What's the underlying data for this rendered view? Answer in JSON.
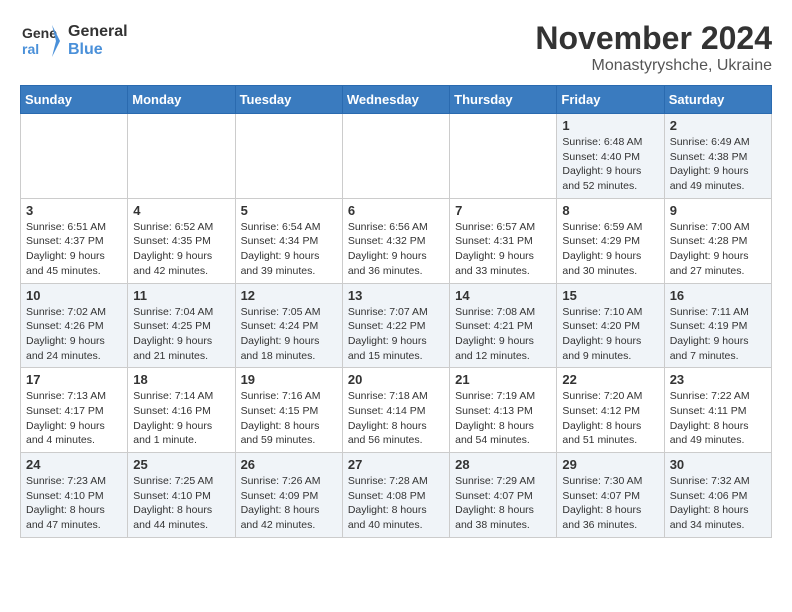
{
  "logo": {
    "line1": "General",
    "line2": "Blue"
  },
  "title": "November 2024",
  "subtitle": "Monastyryshche, Ukraine",
  "days_of_week": [
    "Sunday",
    "Monday",
    "Tuesday",
    "Wednesday",
    "Thursday",
    "Friday",
    "Saturday"
  ],
  "weeks": [
    [
      {
        "day": "",
        "info": ""
      },
      {
        "day": "",
        "info": ""
      },
      {
        "day": "",
        "info": ""
      },
      {
        "day": "",
        "info": ""
      },
      {
        "day": "",
        "info": ""
      },
      {
        "day": "1",
        "info": "Sunrise: 6:48 AM\nSunset: 4:40 PM\nDaylight: 9 hours\nand 52 minutes."
      },
      {
        "day": "2",
        "info": "Sunrise: 6:49 AM\nSunset: 4:38 PM\nDaylight: 9 hours\nand 49 minutes."
      }
    ],
    [
      {
        "day": "3",
        "info": "Sunrise: 6:51 AM\nSunset: 4:37 PM\nDaylight: 9 hours\nand 45 minutes."
      },
      {
        "day": "4",
        "info": "Sunrise: 6:52 AM\nSunset: 4:35 PM\nDaylight: 9 hours\nand 42 minutes."
      },
      {
        "day": "5",
        "info": "Sunrise: 6:54 AM\nSunset: 4:34 PM\nDaylight: 9 hours\nand 39 minutes."
      },
      {
        "day": "6",
        "info": "Sunrise: 6:56 AM\nSunset: 4:32 PM\nDaylight: 9 hours\nand 36 minutes."
      },
      {
        "day": "7",
        "info": "Sunrise: 6:57 AM\nSunset: 4:31 PM\nDaylight: 9 hours\nand 33 minutes."
      },
      {
        "day": "8",
        "info": "Sunrise: 6:59 AM\nSunset: 4:29 PM\nDaylight: 9 hours\nand 30 minutes."
      },
      {
        "day": "9",
        "info": "Sunrise: 7:00 AM\nSunset: 4:28 PM\nDaylight: 9 hours\nand 27 minutes."
      }
    ],
    [
      {
        "day": "10",
        "info": "Sunrise: 7:02 AM\nSunset: 4:26 PM\nDaylight: 9 hours\nand 24 minutes."
      },
      {
        "day": "11",
        "info": "Sunrise: 7:04 AM\nSunset: 4:25 PM\nDaylight: 9 hours\nand 21 minutes."
      },
      {
        "day": "12",
        "info": "Sunrise: 7:05 AM\nSunset: 4:24 PM\nDaylight: 9 hours\nand 18 minutes."
      },
      {
        "day": "13",
        "info": "Sunrise: 7:07 AM\nSunset: 4:22 PM\nDaylight: 9 hours\nand 15 minutes."
      },
      {
        "day": "14",
        "info": "Sunrise: 7:08 AM\nSunset: 4:21 PM\nDaylight: 9 hours\nand 12 minutes."
      },
      {
        "day": "15",
        "info": "Sunrise: 7:10 AM\nSunset: 4:20 PM\nDaylight: 9 hours\nand 9 minutes."
      },
      {
        "day": "16",
        "info": "Sunrise: 7:11 AM\nSunset: 4:19 PM\nDaylight: 9 hours\nand 7 minutes."
      }
    ],
    [
      {
        "day": "17",
        "info": "Sunrise: 7:13 AM\nSunset: 4:17 PM\nDaylight: 9 hours\nand 4 minutes."
      },
      {
        "day": "18",
        "info": "Sunrise: 7:14 AM\nSunset: 4:16 PM\nDaylight: 9 hours\nand 1 minute."
      },
      {
        "day": "19",
        "info": "Sunrise: 7:16 AM\nSunset: 4:15 PM\nDaylight: 8 hours\nand 59 minutes."
      },
      {
        "day": "20",
        "info": "Sunrise: 7:18 AM\nSunset: 4:14 PM\nDaylight: 8 hours\nand 56 minutes."
      },
      {
        "day": "21",
        "info": "Sunrise: 7:19 AM\nSunset: 4:13 PM\nDaylight: 8 hours\nand 54 minutes."
      },
      {
        "day": "22",
        "info": "Sunrise: 7:20 AM\nSunset: 4:12 PM\nDaylight: 8 hours\nand 51 minutes."
      },
      {
        "day": "23",
        "info": "Sunrise: 7:22 AM\nSunset: 4:11 PM\nDaylight: 8 hours\nand 49 minutes."
      }
    ],
    [
      {
        "day": "24",
        "info": "Sunrise: 7:23 AM\nSunset: 4:10 PM\nDaylight: 8 hours\nand 47 minutes."
      },
      {
        "day": "25",
        "info": "Sunrise: 7:25 AM\nSunset: 4:10 PM\nDaylight: 8 hours\nand 44 minutes."
      },
      {
        "day": "26",
        "info": "Sunrise: 7:26 AM\nSunset: 4:09 PM\nDaylight: 8 hours\nand 42 minutes."
      },
      {
        "day": "27",
        "info": "Sunrise: 7:28 AM\nSunset: 4:08 PM\nDaylight: 8 hours\nand 40 minutes."
      },
      {
        "day": "28",
        "info": "Sunrise: 7:29 AM\nSunset: 4:07 PM\nDaylight: 8 hours\nand 38 minutes."
      },
      {
        "day": "29",
        "info": "Sunrise: 7:30 AM\nSunset: 4:07 PM\nDaylight: 8 hours\nand 36 minutes."
      },
      {
        "day": "30",
        "info": "Sunrise: 7:32 AM\nSunset: 4:06 PM\nDaylight: 8 hours\nand 34 minutes."
      }
    ]
  ]
}
